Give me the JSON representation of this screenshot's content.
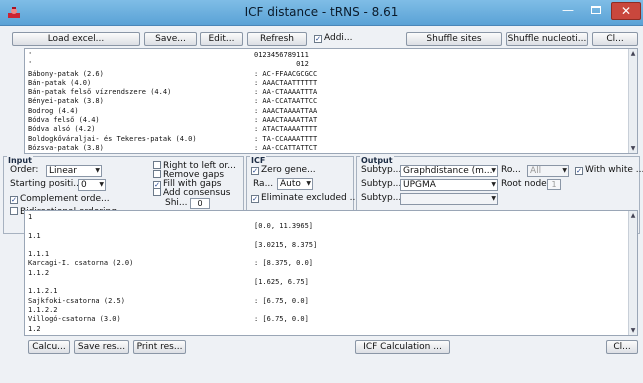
{
  "window": {
    "title": "ICF distance - tRNS - 8.61",
    "minimize_glyph": "—",
    "close_glyph": "✕"
  },
  "toolbar": {
    "load_excel": "Load excel...",
    "save": "Save...",
    "edit": "Edit...",
    "refresh": "Refresh",
    "add_check": "✓",
    "add": "Addi...",
    "shuffle_sites": "Shuffle sites",
    "shuffle_nucleotides": "Shuffle nucleoti...",
    "close": "Cl..."
  },
  "alignment": {
    "lines": [
      {
        "name": "'",
        "seq": "0123456789111"
      },
      {
        "name": "'",
        "seq": "          012"
      },
      {
        "name": "Bábony-patak (2.6)",
        "seq": ": AC-FFAACGCGCC"
      },
      {
        "name": "Bán-patak (4.0)",
        "seq": ": AAACTAATTTTTT"
      },
      {
        "name": "Bán-patak felső vízrendszere (4.4)",
        "seq": ": AA-CTAAAATTTA"
      },
      {
        "name": "Bényei-patak (3.8)",
        "seq": ": AA-CCATAATTCC"
      },
      {
        "name": "Bodrog (4.4)",
        "seq": ": AAACTAAAATTAA"
      },
      {
        "name": "Bódva felső (4.4)",
        "seq": ": AAACTAAAATTAT"
      },
      {
        "name": "Bódva alsó (4.2)",
        "seq": ": ATACTAAAATTTT"
      },
      {
        "name": "Boldogkőváraljai- és Tekeres-patak (4.0)",
        "seq": ": TA-CCAAAATTTT"
      },
      {
        "name": "Bózsva-patak (3.8)",
        "seq": ": AA-CCATTATTCT"
      }
    ]
  },
  "input": {
    "title": "Input",
    "order_label": "Order:",
    "order_value": "Linear",
    "starting_label": "Starting positi...",
    "starting_value": "0",
    "complement_check": "✓",
    "complement": "Complement orde...",
    "bidirectional": "Bidirectional ordering",
    "right_to_left": "Right to left or...",
    "remove_gaps": "Remove gaps",
    "fill_check": "✓",
    "fill_gaps": "Fill with gaps",
    "add_consensus": "Add consensus",
    "shi_label": "Shi...",
    "shi_value": "0"
  },
  "icf": {
    "title": "ICF",
    "zero_check": "✓",
    "zero_gene": "Zero gene...",
    "ra_label": "Ra...",
    "ra_value": "Auto",
    "eliminate_check": "✓",
    "eliminate": "Eliminate excluded ..."
  },
  "output": {
    "title": "Output",
    "subtype_label": "Subtyp...",
    "row1_value": "Graphdistance (m...",
    "ro_label": "Ro...",
    "ro_value": "All",
    "white_check": "✓",
    "with_white": "With white ...",
    "row2_value": "UPGMA",
    "root_label": "Root node:",
    "root_value": "1",
    "row3_value": ""
  },
  "results": {
    "lines": [
      {
        "label": "1",
        "value": ""
      },
      {
        "label": "",
        "value": "[0.0, 11.3965]"
      },
      {
        "label": "1.1",
        "value": ""
      },
      {
        "label": "",
        "value": "[3.0215, 8.375]"
      },
      {
        "label": "1.1.1",
        "value": ""
      },
      {
        "label": "Karcagi-I. csatorna (2.0)",
        "value": ": [8.375, 0.0]"
      },
      {
        "label": "1.1.2",
        "value": ""
      },
      {
        "label": "",
        "value": "[1.625, 6.75]"
      },
      {
        "label": "1.1.2.1",
        "value": ""
      },
      {
        "label": "Sajkfoki-csatorna (2.5)",
        "value": ": [6.75, 0.0]"
      },
      {
        "label": "1.1.2.2",
        "value": ""
      },
      {
        "label": "Villogó-csatorna (3.0)",
        "value": ": [6.75, 0.0]"
      },
      {
        "label": "1.2",
        "value": ""
      }
    ]
  },
  "bottom": {
    "calculate": "Calcu...",
    "save_results": "Save res...",
    "print_results": "Print res...",
    "icf_calculation": "ICF Calculation ...",
    "close": "Cl..."
  }
}
